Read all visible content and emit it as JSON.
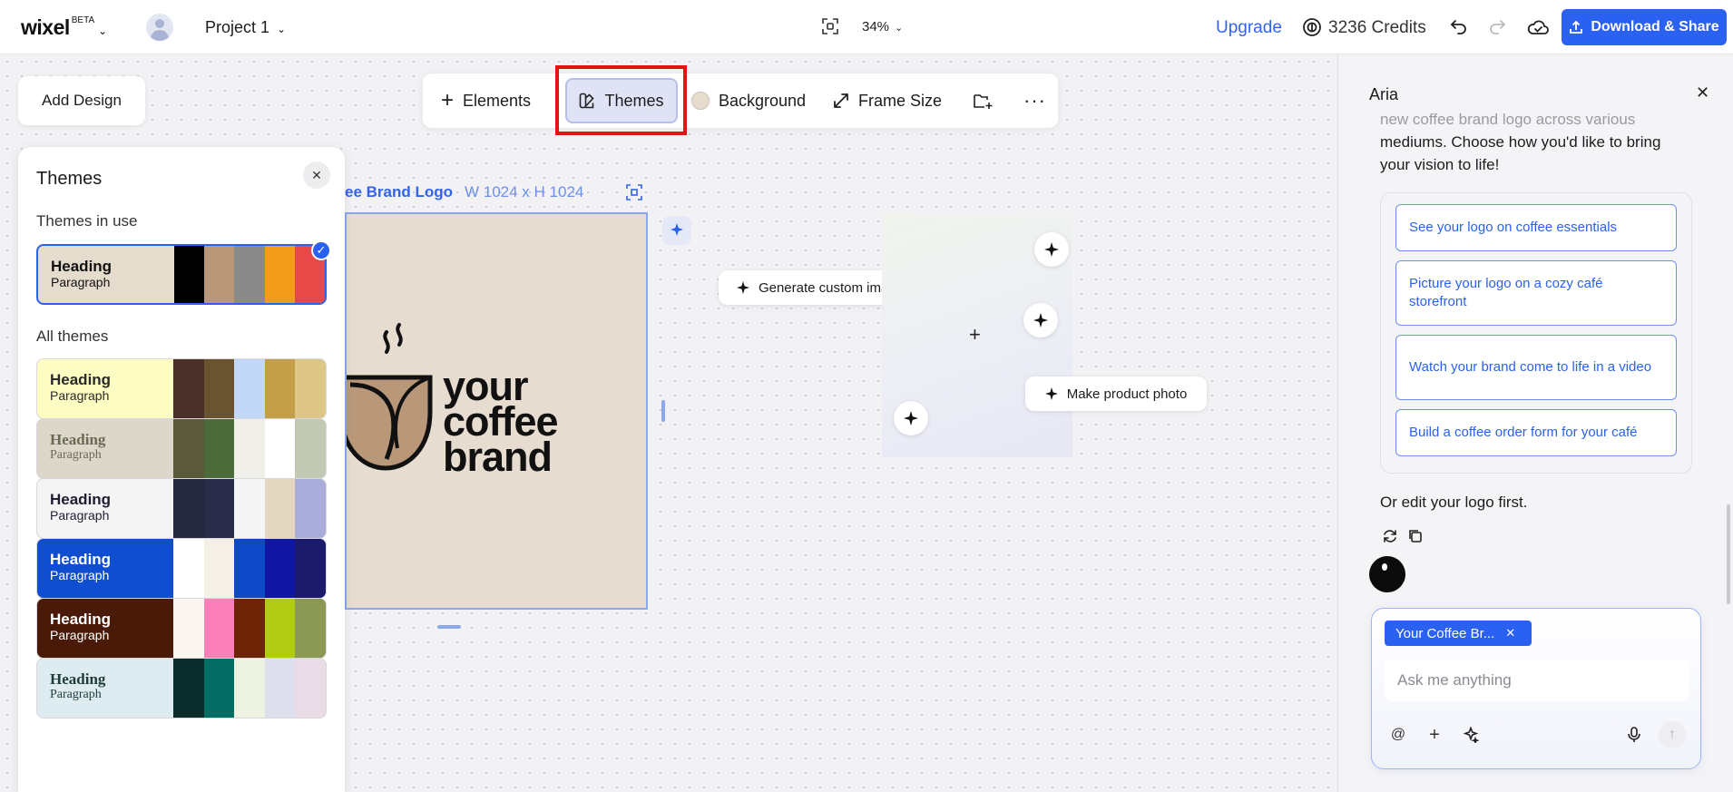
{
  "topbar": {
    "logo": "wixel",
    "logo_badge": "BETA",
    "project_name": "Project 1",
    "zoom": "34%",
    "upgrade_label": "Upgrade",
    "credits": "3236 Credits",
    "download_label": "Download & Share"
  },
  "canvas": {
    "add_design_label": "Add Design",
    "toolbar": {
      "elements": "Elements",
      "themes": "Themes",
      "background": "Background",
      "frame_size": "Frame Size"
    },
    "frame": {
      "label": "ee Brand Logo",
      "size": "W 1024 x H 1024",
      "brand_lines": [
        "your",
        "coffee",
        "brand"
      ]
    },
    "generate_label": "Generate custom image",
    "product_label": "Make product photo"
  },
  "themes_panel": {
    "title": "Themes",
    "in_use_label": "Themes in use",
    "all_label": "All themes",
    "in_use": {
      "heading": "Heading",
      "paragraph": "Paragraph",
      "bg": "#e6dccd",
      "text": "#111111",
      "swatches": [
        "#000000",
        "#b9987a",
        "#8a8a8a",
        "#f39c1c",
        "#e84848"
      ]
    },
    "all": [
      {
        "heading": "Heading",
        "paragraph": "Paragraph",
        "bg": "#fdfcc3",
        "text": "#2a2a2a",
        "swatches": [
          "#4a2e2a",
          "#6a5330",
          "#c3d7f7",
          "#c49f4a",
          "#ddc686"
        ]
      },
      {
        "heading": "Heading",
        "paragraph": "Paragraph",
        "bg": "#dcd6cb",
        "text": "#6a6a52",
        "swatches": [
          "#5a5a3a",
          "#4d6a3a",
          "#f0efe9",
          "#ffffff",
          "#c1c9b3"
        ]
      },
      {
        "heading": "Heading",
        "paragraph": "Paragraph",
        "bg": "#f4f4f4",
        "text": "#1e1e32",
        "swatches": [
          "#26283f",
          "#2a2d4a",
          "#f5f5f5",
          "#e3d7c1",
          "#aaadd9"
        ]
      },
      {
        "heading": "Heading",
        "paragraph": "Paragraph",
        "bg": "#0f4dd1",
        "text": "#ffffff",
        "swatches": [
          "#ffffff",
          "#f5f0e6",
          "#0e49c7",
          "#1217a3",
          "#1b1a6b"
        ]
      },
      {
        "heading": "Heading",
        "paragraph": "Paragraph",
        "bg": "#4a1a08",
        "text": "#ffffff",
        "swatches": [
          "#fbf6f0",
          "#fb80b7",
          "#6e2206",
          "#b0cc12",
          "#8c9955"
        ]
      },
      {
        "heading": "Heading",
        "paragraph": "Paragraph",
        "bg": "#deecf2",
        "text": "#1d3c3a",
        "swatches": [
          "#0b2e2c",
          "#046d63",
          "#eef2e0",
          "#dde0ec",
          "#eadce6"
        ]
      }
    ]
  },
  "aria": {
    "title": "Aria",
    "faded_text": "new coffee brand logo across various",
    "message": "mediums. Choose how you'd like to bring your vision to life!",
    "suggestions": [
      "See your logo on coffee essentials",
      "Picture your logo on a cozy café storefront",
      "Watch your brand come to life in a video",
      "Build a coffee order form for your café"
    ],
    "edit_text": "Or edit your logo first.",
    "chip": "Your Coffee Br...",
    "input_placeholder": "Ask me anything"
  }
}
